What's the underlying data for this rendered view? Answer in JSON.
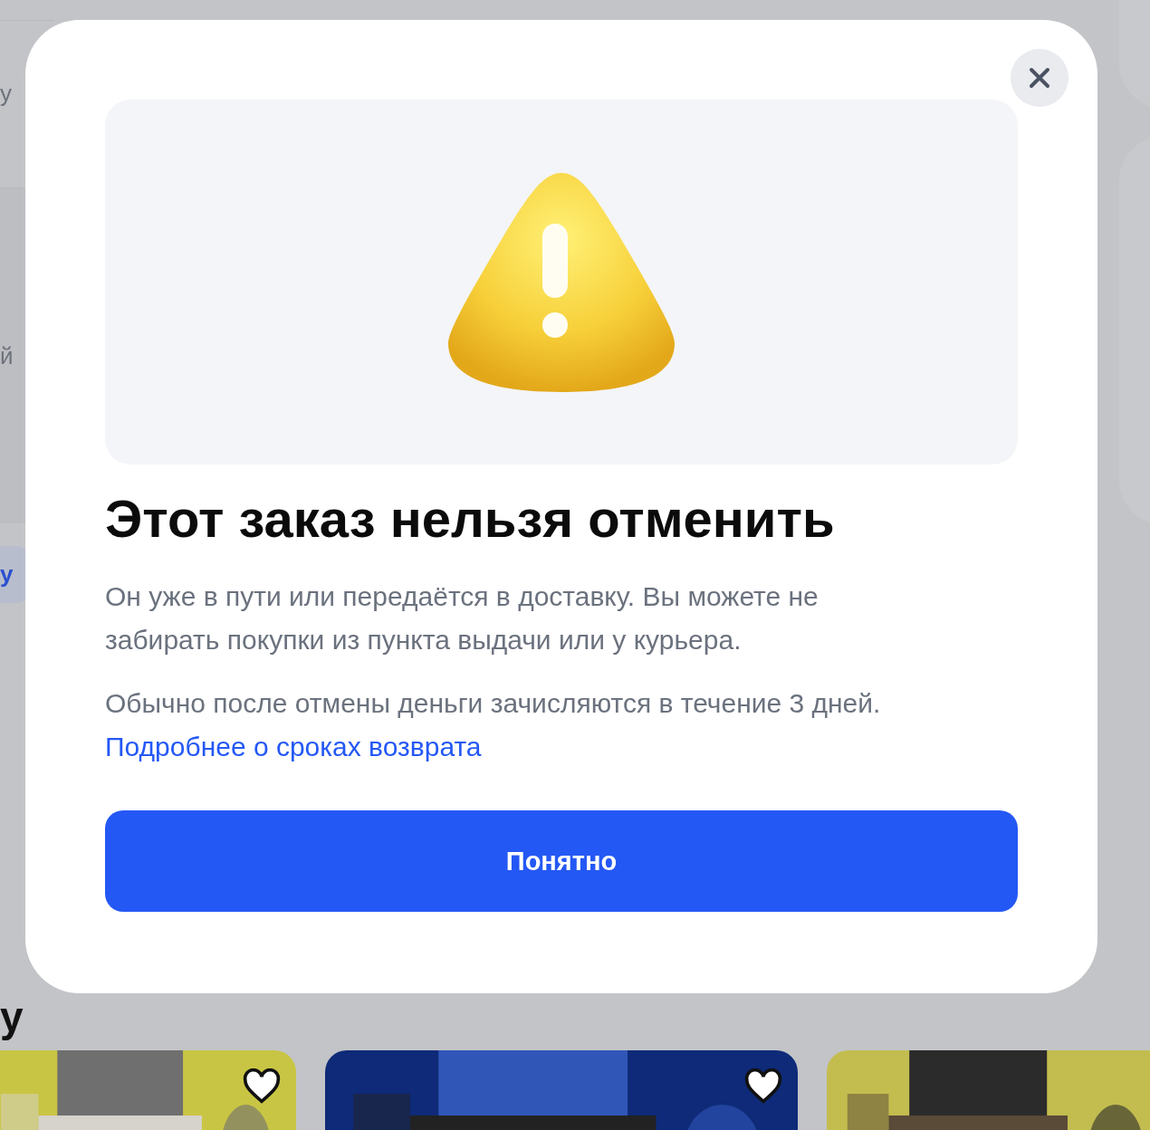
{
  "background": {
    "fragments": [
      {
        "kind": "text",
        "text": "у"
      },
      {
        "kind": "text",
        "text": "й"
      },
      {
        "kind": "button",
        "text": "у"
      }
    ],
    "heading": "у"
  },
  "dialog": {
    "title": "Этот заказ нельзя отменить",
    "paragraphs": [
      "Он уже в пути или передаётся в доставку. Вы можете не забирать покупки из пункта выдачи или у курьера.",
      "Обычно после отмены деньги зачисляются в течение 3 дней."
    ],
    "link": "Подробнее о сроках возврата",
    "button": "Понятно"
  }
}
